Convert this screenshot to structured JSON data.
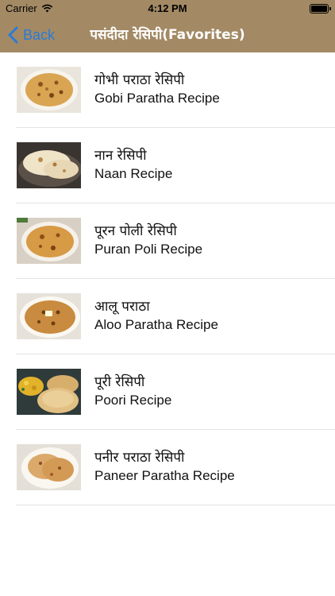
{
  "status_bar": {
    "carrier": "Carrier",
    "time": "4:12 PM"
  },
  "nav": {
    "back_label": "Back",
    "title": "पसंदीदा रेसिपी(Favorites)"
  },
  "recipes": [
    {
      "hindi": "गोभी पराठा रेसिपी",
      "english": "Gobi Paratha Recipe",
      "thumbnail": "gobi-paratha-image"
    },
    {
      "hindi": "नान रेसिपी",
      "english": "Naan Recipe",
      "thumbnail": "naan-image"
    },
    {
      "hindi": "पूरन पोली रेसिपी",
      "english": "Puran Poli Recipe",
      "thumbnail": "puran-poli-image"
    },
    {
      "hindi": "आलू पराठा",
      "english": "Aloo Paratha Recipe",
      "thumbnail": "aloo-paratha-image"
    },
    {
      "hindi": "पूरी रेसिपी",
      "english": "Poori Recipe",
      "thumbnail": "poori-image"
    },
    {
      "hindi": "पनीर पराठा रेसिपी",
      "english": "Paneer Paratha Recipe",
      "thumbnail": "paneer-paratha-image"
    }
  ],
  "colors": {
    "nav_background": "#a38a65",
    "back_tint": "#2a7bd6",
    "title_color": "#ffffff"
  }
}
